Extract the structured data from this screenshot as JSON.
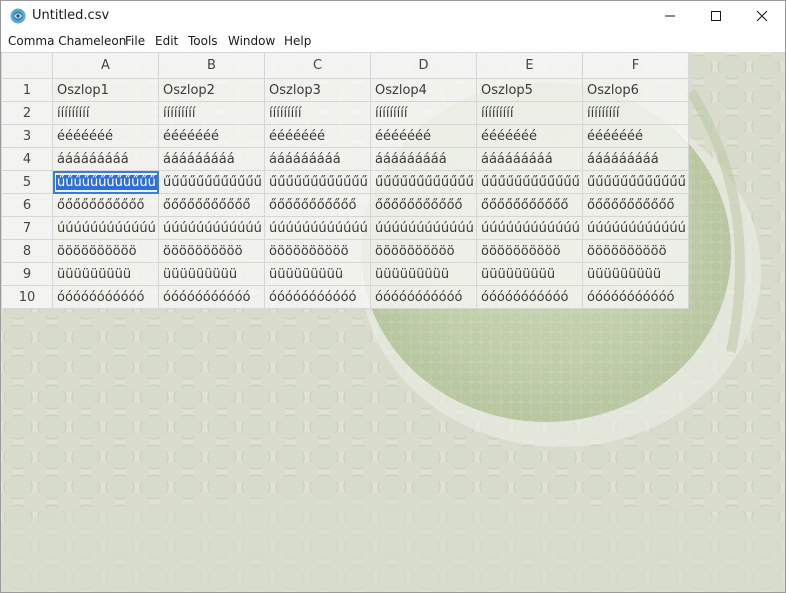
{
  "window": {
    "title": "Untitled.csv",
    "icon": "chameleon-app-icon"
  },
  "menubar": {
    "items": [
      "Comma Chameleon",
      "File",
      "Edit",
      "Tools",
      "Window",
      "Help"
    ]
  },
  "controls": {
    "minimize_icon": "minimize-icon",
    "maximize_icon": "maximize-icon",
    "close_icon": "close-icon"
  },
  "grid": {
    "columns": [
      "A",
      "B",
      "C",
      "D",
      "E",
      "F"
    ],
    "row_numbers": [
      "1",
      "2",
      "3",
      "4",
      "5",
      "6",
      "7",
      "8",
      "9",
      "10"
    ],
    "rows": [
      [
        "Oszlop1",
        "Oszlop2",
        "Oszlop3",
        "Oszlop4",
        "Oszlop5",
        "Oszlop6"
      ],
      [
        "ííííííííí",
        "ííííííííí",
        "ííííííííí",
        "ííííííííí",
        "ííííííííí",
        "ííííííííí"
      ],
      [
        "ééééééé",
        "ééééééé",
        "ééééééé",
        "ééééééé",
        "ééééééé",
        "ééééééé"
      ],
      [
        "ááááááááá",
        "ááááááááá",
        "ááááááááá",
        "ááááááááá",
        "ááááááááá",
        "ááááááááá"
      ],
      [
        "űűűűűűűűűűűű",
        "űűűűűűűűűűűű",
        "űűűűűűűűűűűű",
        "űűűűűűűűűűűű",
        "űűűűűűűűűűűű",
        "űűűűűűűűűűűű"
      ],
      [
        "őőőőőőőőőőő",
        "őőőőőőőőőőő",
        "őőőőőőőőőőő",
        "őőőőőőőőőőő",
        "őőőőőőőőőőő",
        "őőőőőőőőőőő"
      ],
      [
        "úúúúúúúúúúúú",
        "úúúúúúúúúúúú",
        "úúúúúúúúúúúú",
        "úúúúúúúúúúúú",
        "úúúúúúúúúúúú",
        "úúúúúúúúúúúú"
      ],
      [
        "öööööööööö",
        "öööööööööö",
        "öööööööööö",
        "öööööööööö",
        "öööööööööö",
        "öööööööööö"
      ],
      [
        "üüüüüüüüü",
        "üüüüüüüüü",
        "üüüüüüüüü",
        "üüüüüüüüü",
        "üüüüüüüüü",
        "üüüüüüüüü"
      ],
      [
        "óóóóóóóóóóó",
        "óóóóóóóóóóó",
        "óóóóóóóóóóó",
        "óóóóóóóóóóó",
        "óóóóóóóóóóó",
        "óóóóóóóóóóó"
      ]
    ],
    "selected_cell": {
      "row": 5,
      "column": "A"
    }
  },
  "colors": {
    "selection": "#2f6fd6",
    "background_tint": "#e6e7df"
  }
}
